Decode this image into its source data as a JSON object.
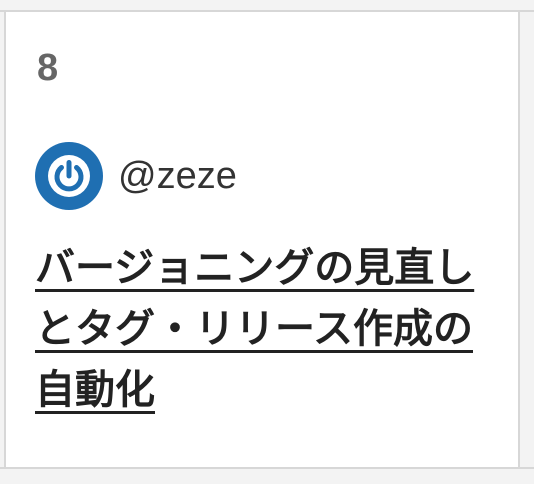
{
  "calendar_cell": {
    "day": "8",
    "author": {
      "username": "@zeze",
      "avatar_icon": "power-logo-icon",
      "avatar_color": "#1f6fb2"
    },
    "article": {
      "title": "バージョニングの見直しとタグ・リリース作成の自動化"
    }
  }
}
